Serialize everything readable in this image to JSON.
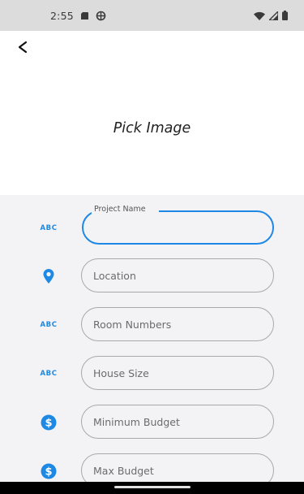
{
  "status_bar": {
    "time": "2:55",
    "left_icons": [
      "sd-card-icon",
      "vpn-icon"
    ],
    "right_icons": [
      "wifi-icon",
      "signal-icon",
      "battery-icon"
    ]
  },
  "app_bar": {
    "back_icon": "back-arrow-icon"
  },
  "image_picker": {
    "label": "Pick Image"
  },
  "form": {
    "accent_color": "#1e88e5",
    "fields": [
      {
        "icon": "abc-icon",
        "icon_text": "ABC",
        "label": "Project Name",
        "placeholder": "",
        "value": "",
        "focused": true
      },
      {
        "icon": "location-pin-icon",
        "placeholder": "Location",
        "value": ""
      },
      {
        "icon": "abc-icon",
        "icon_text": "ABC",
        "placeholder": "Room Numbers",
        "value": ""
      },
      {
        "icon": "abc-icon",
        "icon_text": "ABC",
        "placeholder": "House Size",
        "value": ""
      },
      {
        "icon": "dollar-circle-icon",
        "placeholder": "Minimum Budget",
        "value": ""
      },
      {
        "icon": "dollar-circle-icon",
        "placeholder": "Max Budget",
        "value": ""
      }
    ]
  }
}
